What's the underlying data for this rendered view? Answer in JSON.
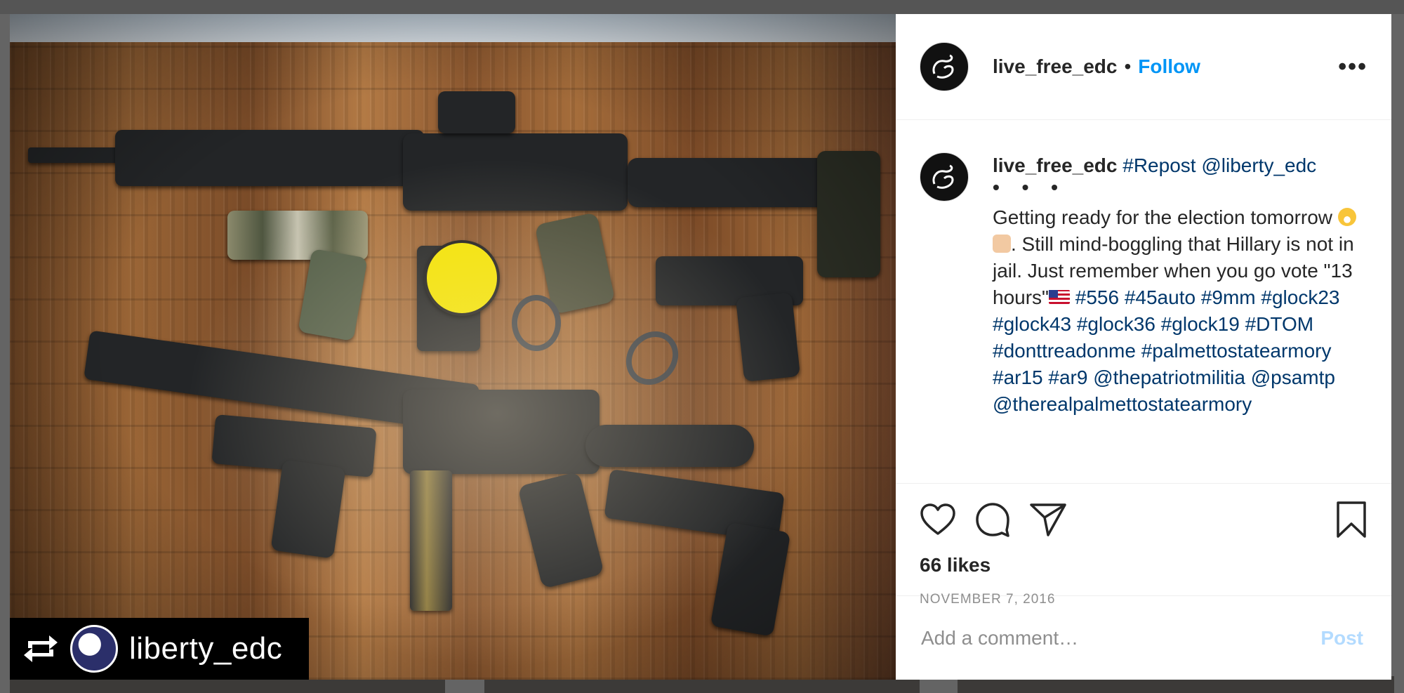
{
  "post": {
    "username": "live_free_edc",
    "separator": "•",
    "follow_label": "Follow",
    "more_label": "•••"
  },
  "photo": {
    "repost_username": "liberty_edc"
  },
  "caption": {
    "username": "live_free_edc",
    "repost_tag": "#Repost",
    "repost_mention": "@liberty_edc",
    "ellipsis": "• • •",
    "text_part1": "Getting ready for the election tomorrow ",
    "text_part2": ". Still mind-boggling that Hillary is not in jail. Just remember when you go vote \"13 hours\"",
    "hashtags_line1": "#556 #45auto #9mm",
    "hashtags_line2": "#glock23 #glock43 #glock36 #glock19",
    "hashtags_line3": "#DTOM #donttreadonme",
    "hashtags_line4": "#palmettostatearmory #ar15 #ar9",
    "mentions_line1": "@thepatriotmilitia @psamtp",
    "mentions_line2": "@therealpalmettostatearmory"
  },
  "stats": {
    "likes": "66 likes",
    "date": "NOVEMBER 7, 2016"
  },
  "comment": {
    "placeholder": "Add a comment…",
    "post_label": "Post"
  },
  "icons": {
    "like": "heart-icon",
    "comment": "comment-icon",
    "share": "send-icon",
    "save": "bookmark-icon",
    "repost": "repost-icon",
    "more": "more-icon"
  },
  "colors": {
    "follow_blue": "#0095f6",
    "hashtag_blue": "#00376b",
    "post_disabled": "#b3dbff",
    "muted": "#8e8e8e"
  }
}
